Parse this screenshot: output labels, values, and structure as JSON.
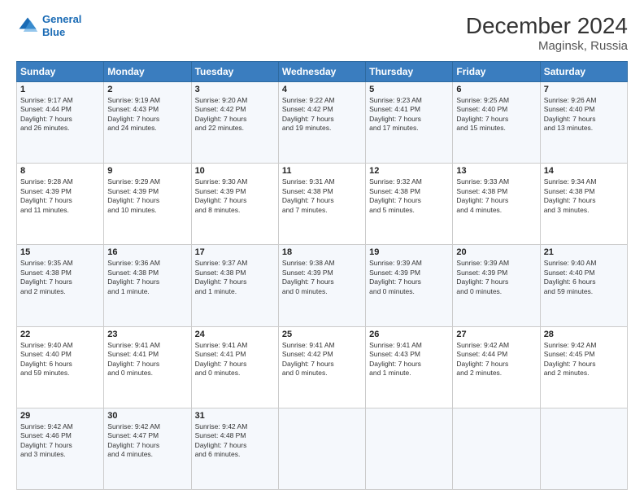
{
  "header": {
    "logo_line1": "General",
    "logo_line2": "Blue",
    "title": "December 2024",
    "subtitle": "Maginsk, Russia"
  },
  "days_of_week": [
    "Sunday",
    "Monday",
    "Tuesday",
    "Wednesday",
    "Thursday",
    "Friday",
    "Saturday"
  ],
  "weeks": [
    [
      {
        "day": "1",
        "detail": "Sunrise: 9:17 AM\nSunset: 4:44 PM\nDaylight: 7 hours\nand 26 minutes."
      },
      {
        "day": "2",
        "detail": "Sunrise: 9:19 AM\nSunset: 4:43 PM\nDaylight: 7 hours\nand 24 minutes."
      },
      {
        "day": "3",
        "detail": "Sunrise: 9:20 AM\nSunset: 4:42 PM\nDaylight: 7 hours\nand 22 minutes."
      },
      {
        "day": "4",
        "detail": "Sunrise: 9:22 AM\nSunset: 4:42 PM\nDaylight: 7 hours\nand 19 minutes."
      },
      {
        "day": "5",
        "detail": "Sunrise: 9:23 AM\nSunset: 4:41 PM\nDaylight: 7 hours\nand 17 minutes."
      },
      {
        "day": "6",
        "detail": "Sunrise: 9:25 AM\nSunset: 4:40 PM\nDaylight: 7 hours\nand 15 minutes."
      },
      {
        "day": "7",
        "detail": "Sunrise: 9:26 AM\nSunset: 4:40 PM\nDaylight: 7 hours\nand 13 minutes."
      }
    ],
    [
      {
        "day": "8",
        "detail": "Sunrise: 9:28 AM\nSunset: 4:39 PM\nDaylight: 7 hours\nand 11 minutes."
      },
      {
        "day": "9",
        "detail": "Sunrise: 9:29 AM\nSunset: 4:39 PM\nDaylight: 7 hours\nand 10 minutes."
      },
      {
        "day": "10",
        "detail": "Sunrise: 9:30 AM\nSunset: 4:39 PM\nDaylight: 7 hours\nand 8 minutes."
      },
      {
        "day": "11",
        "detail": "Sunrise: 9:31 AM\nSunset: 4:38 PM\nDaylight: 7 hours\nand 7 minutes."
      },
      {
        "day": "12",
        "detail": "Sunrise: 9:32 AM\nSunset: 4:38 PM\nDaylight: 7 hours\nand 5 minutes."
      },
      {
        "day": "13",
        "detail": "Sunrise: 9:33 AM\nSunset: 4:38 PM\nDaylight: 7 hours\nand 4 minutes."
      },
      {
        "day": "14",
        "detail": "Sunrise: 9:34 AM\nSunset: 4:38 PM\nDaylight: 7 hours\nand 3 minutes."
      }
    ],
    [
      {
        "day": "15",
        "detail": "Sunrise: 9:35 AM\nSunset: 4:38 PM\nDaylight: 7 hours\nand 2 minutes."
      },
      {
        "day": "16",
        "detail": "Sunrise: 9:36 AM\nSunset: 4:38 PM\nDaylight: 7 hours\nand 1 minute."
      },
      {
        "day": "17",
        "detail": "Sunrise: 9:37 AM\nSunset: 4:38 PM\nDaylight: 7 hours\nand 1 minute."
      },
      {
        "day": "18",
        "detail": "Sunrise: 9:38 AM\nSunset: 4:39 PM\nDaylight: 7 hours\nand 0 minutes."
      },
      {
        "day": "19",
        "detail": "Sunrise: 9:39 AM\nSunset: 4:39 PM\nDaylight: 7 hours\nand 0 minutes."
      },
      {
        "day": "20",
        "detail": "Sunrise: 9:39 AM\nSunset: 4:39 PM\nDaylight: 7 hours\nand 0 minutes."
      },
      {
        "day": "21",
        "detail": "Sunrise: 9:40 AM\nSunset: 4:40 PM\nDaylight: 6 hours\nand 59 minutes."
      }
    ],
    [
      {
        "day": "22",
        "detail": "Sunrise: 9:40 AM\nSunset: 4:40 PM\nDaylight: 6 hours\nand 59 minutes."
      },
      {
        "day": "23",
        "detail": "Sunrise: 9:41 AM\nSunset: 4:41 PM\nDaylight: 7 hours\nand 0 minutes."
      },
      {
        "day": "24",
        "detail": "Sunrise: 9:41 AM\nSunset: 4:41 PM\nDaylight: 7 hours\nand 0 minutes."
      },
      {
        "day": "25",
        "detail": "Sunrise: 9:41 AM\nSunset: 4:42 PM\nDaylight: 7 hours\nand 0 minutes."
      },
      {
        "day": "26",
        "detail": "Sunrise: 9:41 AM\nSunset: 4:43 PM\nDaylight: 7 hours\nand 1 minute."
      },
      {
        "day": "27",
        "detail": "Sunrise: 9:42 AM\nSunset: 4:44 PM\nDaylight: 7 hours\nand 2 minutes."
      },
      {
        "day": "28",
        "detail": "Sunrise: 9:42 AM\nSunset: 4:45 PM\nDaylight: 7 hours\nand 2 minutes."
      }
    ],
    [
      {
        "day": "29",
        "detail": "Sunrise: 9:42 AM\nSunset: 4:46 PM\nDaylight: 7 hours\nand 3 minutes."
      },
      {
        "day": "30",
        "detail": "Sunrise: 9:42 AM\nSunset: 4:47 PM\nDaylight: 7 hours\nand 4 minutes."
      },
      {
        "day": "31",
        "detail": "Sunrise: 9:42 AM\nSunset: 4:48 PM\nDaylight: 7 hours\nand 6 minutes."
      },
      {
        "day": "",
        "detail": ""
      },
      {
        "day": "",
        "detail": ""
      },
      {
        "day": "",
        "detail": ""
      },
      {
        "day": "",
        "detail": ""
      }
    ]
  ]
}
